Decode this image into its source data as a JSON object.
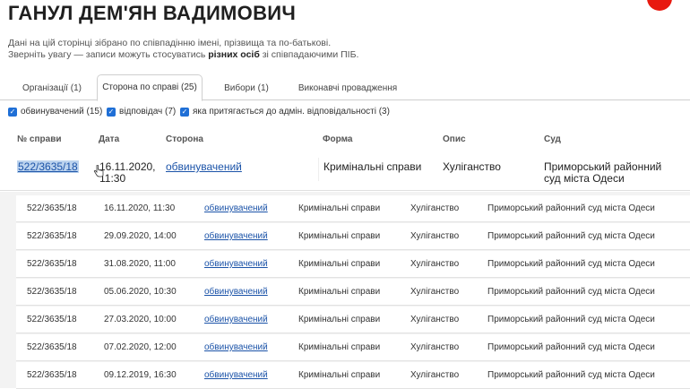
{
  "page": {
    "title": "ГАНУЛ ДЕМ'ЯН ВАДИМОВИЧ",
    "info_line1": "Дані на цій сторінці зібрано по співпадінню імені, прізвища та по-батькові.",
    "info_line2_prefix": "Зверніть увагу — записи можуть стосуватись ",
    "info_line2_bold": "різних осіб",
    "info_line2_suffix": " зі співпадаючими ПІБ."
  },
  "tabs": [
    {
      "label": "Організації (1)",
      "active": false
    },
    {
      "label": "Сторона по справі (25)",
      "active": true
    },
    {
      "label": "Вибори (1)",
      "active": false
    },
    {
      "label": "Виконавчі провадження",
      "active": false
    }
  ],
  "filters": [
    {
      "label": "обвинувачений (15)",
      "checked": true
    },
    {
      "label": "відповідач (7)",
      "checked": true
    },
    {
      "label": "яка притягається до адмін. відповідальності (3)",
      "checked": true
    }
  ],
  "table": {
    "headers": [
      "№ справи",
      "Дата",
      "Сторона",
      "Форма",
      "Опис",
      "Суд"
    ],
    "main_row": {
      "case_no": "522/3635/18",
      "date_line1": "16.11.2020,",
      "date_line2": "11:30",
      "party": "обвинувачений",
      "form": "Кримінальні справи",
      "description": "Хуліганство",
      "court_line1": "Приморський районний",
      "court_line2": "суд міста Одеси"
    },
    "sub_rows": [
      {
        "case_no": "522/3635/18",
        "date": "16.11.2020, 11:30",
        "party": "обвинувачений",
        "form": "Кримінальні справи",
        "description": "Хуліганство",
        "court": "Приморський районний суд міста Одеси"
      },
      {
        "case_no": "522/3635/18",
        "date": "29.09.2020, 14:00",
        "party": "обвинувачений",
        "form": "Кримінальні справи",
        "description": "Хуліганство",
        "court": "Приморський районний суд міста Одеси"
      },
      {
        "case_no": "522/3635/18",
        "date": "31.08.2020, 11:00",
        "party": "обвинувачений",
        "form": "Кримінальні справи",
        "description": "Хуліганство",
        "court": "Приморський районний суд міста Одеси"
      },
      {
        "case_no": "522/3635/18",
        "date": "05.06.2020, 10:30",
        "party": "обвинувачений",
        "form": "Кримінальні справи",
        "description": "Хуліганство",
        "court": "Приморський районний суд міста Одеси"
      },
      {
        "case_no": "522/3635/18",
        "date": "27.03.2020, 10:00",
        "party": "обвинувачений",
        "form": "Кримінальні справи",
        "description": "Хуліганство",
        "court": "Приморський районний суд міста Одеси"
      },
      {
        "case_no": "522/3635/18",
        "date": "07.02.2020, 12:00",
        "party": "обвинувачений",
        "form": "Кримінальні справи",
        "description": "Хуліганство",
        "court": "Приморський районний суд міста Одеси"
      },
      {
        "case_no": "522/3635/18",
        "date": "09.12.2019, 16:30",
        "party": "обвинувачений",
        "form": "Кримінальні справи",
        "description": "Хуліганство",
        "court": "Приморський районний суд міста Одеси"
      }
    ]
  },
  "colors": {
    "accent": "#e8190f",
    "link": "#1b53a8",
    "checkbox": "#1f6fd6"
  },
  "icons": {
    "cursor": "hand-pointer-icon",
    "checkbox": "checkbox-checked-icon"
  }
}
